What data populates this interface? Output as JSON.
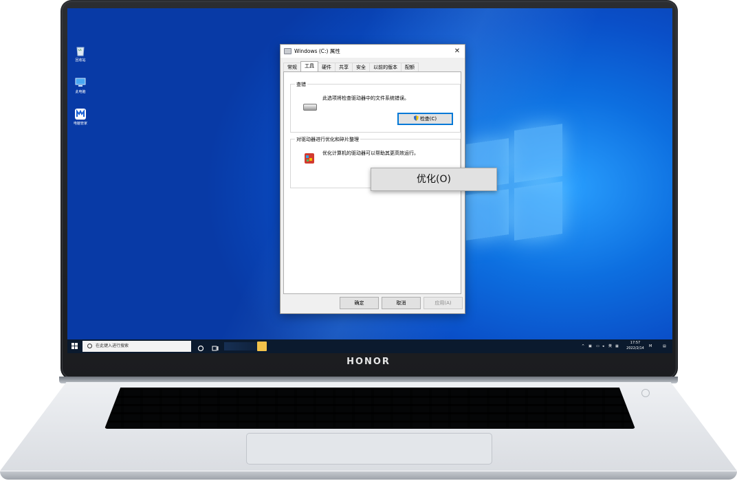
{
  "device": {
    "brand": "HONOR"
  },
  "desktop": {
    "icons": [
      {
        "label": "回收站",
        "icon": "recycle-bin-icon"
      },
      {
        "label": "此电脑",
        "icon": "computer-icon"
      },
      {
        "label": "电脑管家",
        "icon": "pc-manager-icon"
      }
    ]
  },
  "dialog": {
    "title": "Windows (C:) 属性",
    "close": "✕",
    "tabs": [
      "常规",
      "工具",
      "硬件",
      "共享",
      "安全",
      "以前的版本",
      "配额"
    ],
    "active_tab": "工具",
    "check_group": {
      "title": "查错",
      "description": "此选项将检查驱动器中的文件系统错误。",
      "button": "检查(C)"
    },
    "optimize_group": {
      "title": "对驱动器进行优化和碎片整理",
      "description": "优化计算机的驱动器可以帮助其更高效运行。",
      "button": "优化(O)"
    },
    "footer": {
      "ok": "确定",
      "cancel": "取消",
      "apply": "应用(A)"
    }
  },
  "taskbar": {
    "search_placeholder": "在此键入进行搜索",
    "tray": {
      "lang": "英",
      "time": "17:57",
      "date": "2022/2/14"
    }
  },
  "colors": {
    "accent": "#0078d7",
    "desktop": "#0a4fc8",
    "taskbar": "#0b1a2e"
  }
}
